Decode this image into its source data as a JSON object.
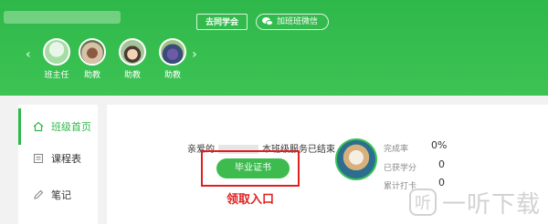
{
  "header": {
    "alumni_button": "去同学会",
    "wechat_button": "加班班微信"
  },
  "teachers": [
    {
      "label": "班主任"
    },
    {
      "label": "助教"
    },
    {
      "label": "助教"
    },
    {
      "label": "助教"
    }
  ],
  "sidebar": {
    "items": [
      {
        "label": "班级首页",
        "icon": "home-icon",
        "active": true
      },
      {
        "label": "课程表",
        "icon": "schedule-icon",
        "active": false
      },
      {
        "label": "笔记",
        "icon": "notes-icon",
        "active": false
      }
    ]
  },
  "main": {
    "greeting_prefix": "亲爱的",
    "greeting_suffix": "本班级服务已结束",
    "cert_button": "毕业证书",
    "claim_label": "领取入口"
  },
  "stats": [
    {
      "label": "完成率",
      "value": "0%"
    },
    {
      "label": "已获学分",
      "value": "0"
    },
    {
      "label": "累计打卡",
      "value": "0"
    }
  ],
  "watermark": {
    "mark": "听",
    "text": "一听下载"
  },
  "colors": {
    "brand_green": "#3cc354",
    "highlight_red": "#e02020"
  }
}
